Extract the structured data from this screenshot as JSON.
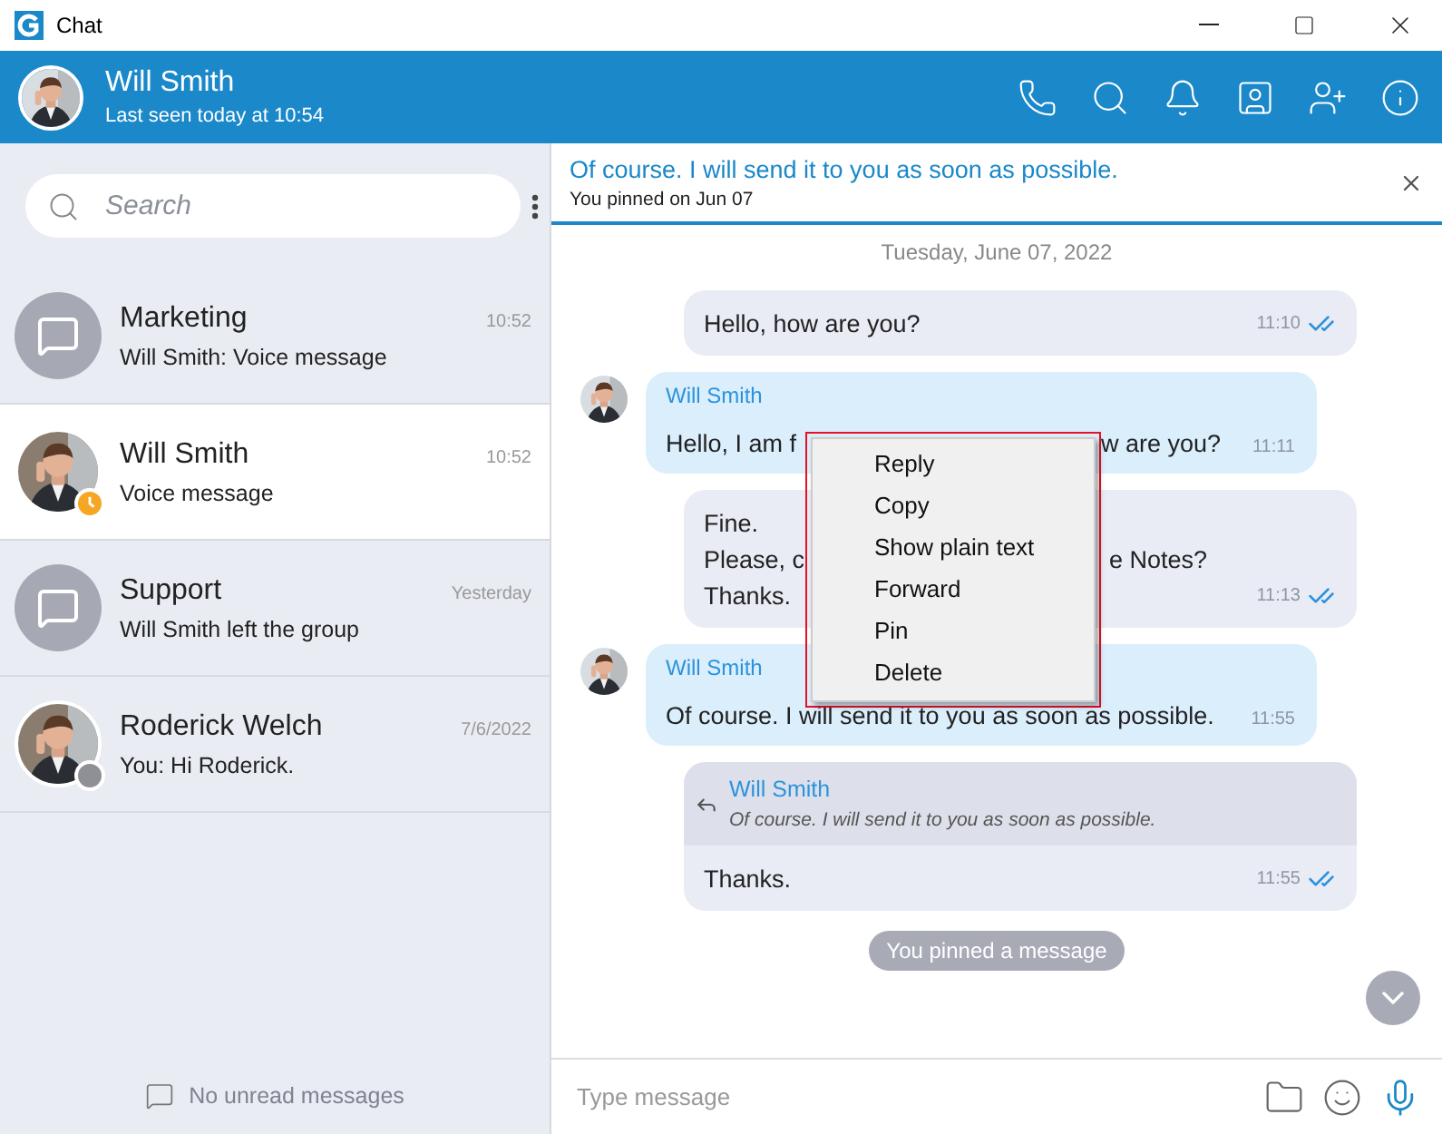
{
  "window": {
    "title": "Chat"
  },
  "header": {
    "name": "Will Smith",
    "status": "Last seen today at 10:54"
  },
  "search": {
    "placeholder": "Search"
  },
  "chats": [
    {
      "name": "Marketing",
      "preview": "Will Smith: Voice message",
      "time": "10:52",
      "kind": "group",
      "selected": false
    },
    {
      "name": "Will Smith",
      "preview": "Voice message",
      "time": "10:52",
      "kind": "person",
      "status": {
        "kind": "clock",
        "color": "#f5a623"
      },
      "selected": true
    },
    {
      "name": "Support",
      "preview": "Will Smith left the group",
      "time": "Yesterday",
      "kind": "group",
      "selected": false
    },
    {
      "name": "Roderick Welch",
      "preview": "You: Hi Roderick.",
      "time": "7/6/2022",
      "kind": "person",
      "status": {
        "kind": "dot",
        "color": "#8e9096"
      },
      "selected": false
    }
  ],
  "sidebar_footer": "No unread messages",
  "pinned": {
    "text": "Of course. I will send it to you as soon as possible.",
    "note": "You pinned on Jun 07"
  },
  "date_separator": "Tuesday, June 07, 2022",
  "messages": [
    {
      "kind": "outgoing",
      "lines": [
        [
          "Hello, how are you?"
        ]
      ],
      "time": "11:10",
      "read": true
    },
    {
      "kind": "incoming",
      "sender": "Will Smith",
      "lines": [
        [
          "Hello, I am f",
          "w are you?"
        ]
      ],
      "time": "11:11"
    },
    {
      "kind": "outgoing",
      "lines": [
        [
          "Fine."
        ],
        [
          "Please, c",
          "e Notes?"
        ],
        [
          "Thanks."
        ]
      ],
      "time": "11:13",
      "read": true
    },
    {
      "kind": "incoming",
      "sender": "Will Smith",
      "lines": [
        [
          "Of course. I will send it to you as soon as possible."
        ]
      ],
      "time": "11:55"
    },
    {
      "kind": "outgoing",
      "quote": {
        "sender": "Will Smith",
        "text": "Of course. I will send it to you as soon as possible."
      },
      "lines": [
        [
          "Thanks."
        ]
      ],
      "time": "11:55",
      "read": true
    }
  ],
  "notice": "You pinned a message",
  "context_menu": [
    "Reply",
    "Copy",
    "Show plain text",
    "Forward",
    "Pin",
    "Delete"
  ],
  "composer": {
    "placeholder": "Type message"
  }
}
